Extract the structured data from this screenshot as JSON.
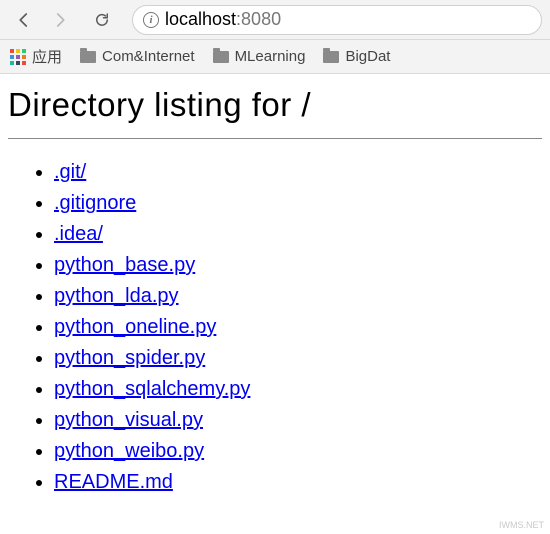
{
  "browser": {
    "url_host": "localhost",
    "url_port": ":8080"
  },
  "bookmarks": {
    "apps_label": "应用",
    "items": [
      "Com&Internet",
      "MLearning",
      "BigDat"
    ]
  },
  "page": {
    "title": "Directory listing for /",
    "entries": [
      ".git/",
      ".gitignore",
      ".idea/",
      "python_base.py",
      "python_lda.py",
      "python_oneline.py",
      "python_spider.py",
      "python_sqlalchemy.py",
      "python_visual.py",
      "python_weibo.py",
      "README.md"
    ]
  },
  "watermark": "IWMS.NET"
}
